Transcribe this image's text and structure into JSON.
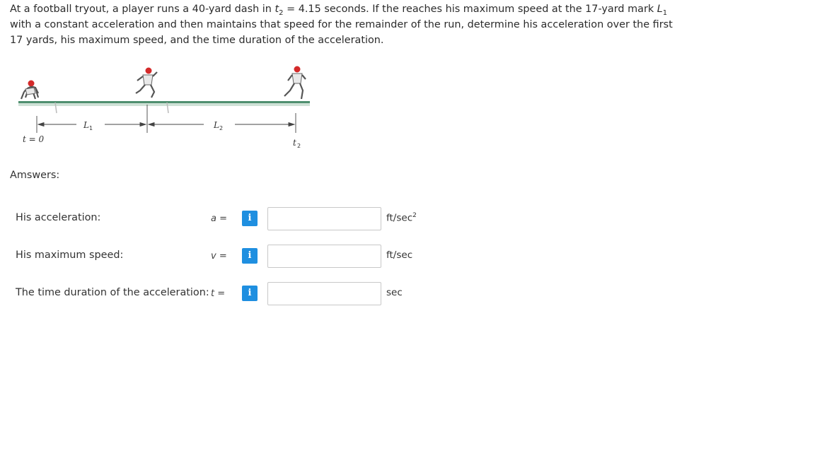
{
  "problem": {
    "text_1": "At a football tryout, a player runs a 40-yard dash in ",
    "t_symbol": "t",
    "t_sub": "2",
    "text_2": " = 4.15 seconds. If the reaches his maximum speed at the 17-yard mark ",
    "L_symbol": "L",
    "L_sub": "1",
    "text_3": " with a constant acceleration and then maintains that speed for the remainder of the run, determine his acceleration over the first 17 yards, his maximum speed, and the time duration of the acceleration."
  },
  "figure": {
    "L1_label": "L",
    "L1_sub": "1",
    "L2_label": "L",
    "L2_sub": "2",
    "t0_label": "t = 0",
    "t2_label": "t",
    "t2_sub": "2",
    "ground_color": "#4f8f6f",
    "jersey_color": "#d42a2a"
  },
  "answers_label": "Amswers:",
  "rows": [
    {
      "label": "His acceleration:",
      "var": "a",
      "eq": "=",
      "info_icon": "i",
      "value": "",
      "unit": "ft/sec",
      "unit_sup": "2"
    },
    {
      "label": "His maximum speed:",
      "var": "v",
      "eq": "=",
      "info_icon": "i",
      "value": "",
      "unit": "ft/sec",
      "unit_sup": ""
    },
    {
      "label": "The time duration of the acceleration:",
      "var": "t",
      "eq": "=",
      "info_icon": "i",
      "value": "",
      "unit": "sec",
      "unit_sup": ""
    }
  ],
  "colors": {
    "info_button": "#1f8fe0",
    "input_border": "#c8c8c8"
  }
}
